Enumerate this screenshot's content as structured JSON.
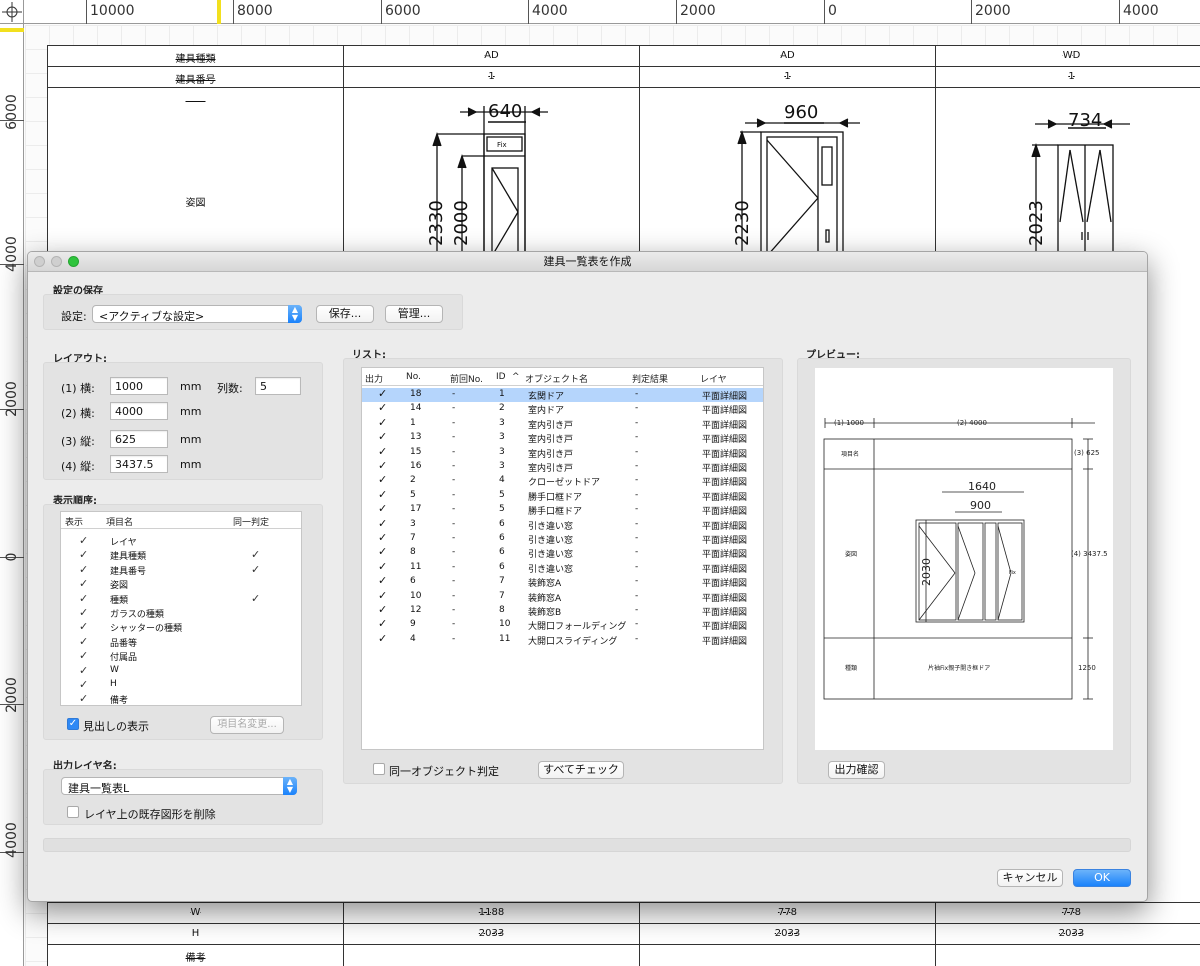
{
  "rulers": {
    "top_labels": [
      "10000",
      "8000",
      "6000",
      "4000",
      "2000",
      "0",
      "2000",
      "4000"
    ],
    "left_labels": [
      "6000",
      "4000",
      "2000",
      "0",
      "2000",
      "4000"
    ]
  },
  "cad": {
    "row_labels": {
      "type": "建具種類",
      "number": "建具番号",
      "figure": "姿図",
      "w": "W",
      "h": "H",
      "remarks": "備考"
    },
    "columns": [
      {
        "type": "AD",
        "number": "1",
        "w": "1188",
        "h": "2033",
        "width_dim": "640",
        "height_dims": [
          "2330",
          "2000"
        ],
        "fix_label": "Fix"
      },
      {
        "type": "AD",
        "number": "1",
        "w": "778",
        "h": "2033",
        "width_dim": "960",
        "height_dims": [
          "2230"
        ]
      },
      {
        "type": "WD",
        "number": "1",
        "w": "778",
        "h": "2033",
        "width_dim": "734",
        "height_dims": [
          "2023"
        ]
      }
    ]
  },
  "dialog": {
    "title": "建具一覧表を作成",
    "settings_section": {
      "label": "設定の保存",
      "setting_label": "設定:",
      "setting_value": "<アクティブな設定>",
      "save_button": "保存...",
      "manage_button": "管理..."
    },
    "layout_section": {
      "label": "レイアウト:",
      "fields": [
        {
          "label": "(1) 横:",
          "value": "1000",
          "unit": "mm"
        },
        {
          "label": "(2) 横:",
          "value": "4000",
          "unit": "mm"
        },
        {
          "label": "(3) 縦:",
          "value": "625",
          "unit": "mm"
        },
        {
          "label": "(4) 縦:",
          "value": "3437.5",
          "unit": "mm"
        }
      ],
      "columns_label": "列数:",
      "columns_value": "5"
    },
    "order_section": {
      "label": "表示順序:",
      "headers": [
        "表示",
        "項目名",
        "同一判定"
      ],
      "items": [
        {
          "name": "レイヤ",
          "same": false
        },
        {
          "name": "建具種類",
          "same": true
        },
        {
          "name": "建具番号",
          "same": true
        },
        {
          "name": "姿図",
          "same": false
        },
        {
          "name": "種類",
          "same": true
        },
        {
          "name": "ガラスの種類",
          "same": false
        },
        {
          "name": "シャッターの種類",
          "same": false
        },
        {
          "name": "品番等",
          "same": false
        },
        {
          "name": "付属品",
          "same": false
        },
        {
          "name": "W",
          "same": false
        },
        {
          "name": "H",
          "same": false
        },
        {
          "name": "備考",
          "same": false
        }
      ],
      "show_headings_label": "見出しの表示",
      "show_headings_checked": true,
      "rename_button": "項目名変更..."
    },
    "output_layer_section": {
      "label": "出力レイヤ名:",
      "value": "建具一覧表L",
      "delete_existing_label": "レイヤ上の既存図形を削除",
      "delete_existing_checked": false
    },
    "list_section": {
      "label": "リスト:",
      "headers": [
        "出力",
        "No.",
        "前回No.",
        "ID",
        "^",
        "オブジェクト名",
        "判定結果",
        "レイヤ"
      ],
      "rows": [
        {
          "no": "18",
          "prev": "-",
          "id": "1",
          "name": "玄関ドア",
          "result": "-",
          "layer": "平面詳細図"
        },
        {
          "no": "14",
          "prev": "-",
          "id": "2",
          "name": "室内ドア",
          "result": "-",
          "layer": "平面詳細図"
        },
        {
          "no": "1",
          "prev": "-",
          "id": "3",
          "name": "室内引き戸",
          "result": "-",
          "layer": "平面詳細図"
        },
        {
          "no": "13",
          "prev": "-",
          "id": "3",
          "name": "室内引き戸",
          "result": "-",
          "layer": "平面詳細図"
        },
        {
          "no": "15",
          "prev": "-",
          "id": "3",
          "name": "室内引き戸",
          "result": "-",
          "layer": "平面詳細図"
        },
        {
          "no": "16",
          "prev": "-",
          "id": "3",
          "name": "室内引き戸",
          "result": "-",
          "layer": "平面詳細図"
        },
        {
          "no": "2",
          "prev": "-",
          "id": "4",
          "name": "クローゼットドア",
          "result": "-",
          "layer": "平面詳細図"
        },
        {
          "no": "5",
          "prev": "-",
          "id": "5",
          "name": "勝手口框ドア",
          "result": "-",
          "layer": "平面詳細図"
        },
        {
          "no": "17",
          "prev": "-",
          "id": "5",
          "name": "勝手口框ドア",
          "result": "-",
          "layer": "平面詳細図"
        },
        {
          "no": "3",
          "prev": "-",
          "id": "6",
          "name": "引き違い窓",
          "result": "-",
          "layer": "平面詳細図"
        },
        {
          "no": "7",
          "prev": "-",
          "id": "6",
          "name": "引き違い窓",
          "result": "-",
          "layer": "平面詳細図"
        },
        {
          "no": "8",
          "prev": "-",
          "id": "6",
          "name": "引き違い窓",
          "result": "-",
          "layer": "平面詳細図"
        },
        {
          "no": "11",
          "prev": "-",
          "id": "6",
          "name": "引き違い窓",
          "result": "-",
          "layer": "平面詳細図"
        },
        {
          "no": "6",
          "prev": "-",
          "id": "7",
          "name": "装飾窓A",
          "result": "-",
          "layer": "平面詳細図"
        },
        {
          "no": "10",
          "prev": "-",
          "id": "7",
          "name": "装飾窓A",
          "result": "-",
          "layer": "平面詳細図"
        },
        {
          "no": "12",
          "prev": "-",
          "id": "8",
          "name": "装飾窓B",
          "result": "-",
          "layer": "平面詳細図"
        },
        {
          "no": "9",
          "prev": "-",
          "id": "10",
          "name": "大開口フォールディング",
          "result": "-",
          "layer": "平面詳細図"
        },
        {
          "no": "4",
          "prev": "-",
          "id": "11",
          "name": "大開口スライディング",
          "result": "-",
          "layer": "平面詳細図"
        }
      ],
      "same_object_label": "同一オブジェクト判定",
      "same_object_checked": false,
      "check_all_button": "すべてチェック"
    },
    "preview_section": {
      "label": "プレビュー:",
      "dim_1": "(1) 1000",
      "dim_2": "(2) 4000",
      "dim_3": "(3) 625",
      "dim_4": "(4) 3437.5",
      "dim_5": "1250",
      "row_item_name": "項目名",
      "row_figure": "姿図",
      "row_kind": "種類",
      "kind_value": "片袖Fix親子開き框ドア",
      "width_dims": [
        "1640",
        "900"
      ],
      "height_dim": "2030",
      "fix_label": "Fix",
      "confirm_button": "出力確認"
    },
    "cancel_button": "キャンセル",
    "ok_button": "OK"
  }
}
